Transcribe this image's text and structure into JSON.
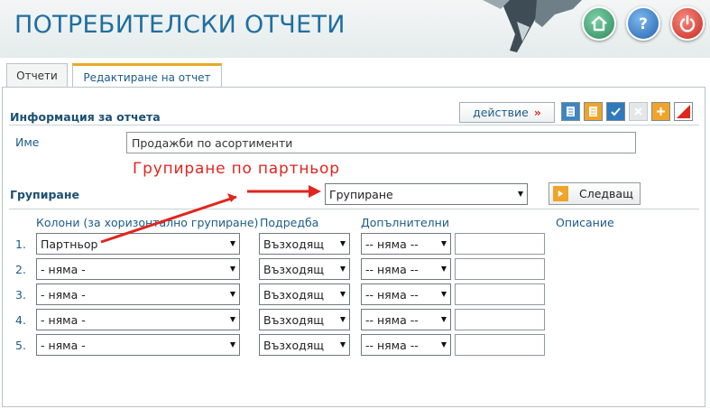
{
  "header": {
    "title": "ПОТРЕБИТЕЛСКИ ОТЧЕТИ",
    "buttons": [
      "home-icon",
      "help-icon",
      "power-icon"
    ]
  },
  "tabs": [
    {
      "label": "Отчети",
      "active": false
    },
    {
      "label": "Редактиране на отчет",
      "active": true
    }
  ],
  "report_info": {
    "title": "Информация за отчета",
    "action_label": "действие",
    "action_arrow": "»",
    "toolbar": [
      "report-icon",
      "report-alt-icon",
      "check-icon",
      "close-icon",
      "add-icon",
      "clear-icon"
    ]
  },
  "name": {
    "label": "Име",
    "value": "Продажби по асортименти"
  },
  "annotation": "Групиране по партньор",
  "grouping": {
    "label": "Групиране",
    "selected": "Групиране",
    "next_label": "Следващ"
  },
  "columns_header": {
    "columns": "Колони (за хоризонтално групиране)",
    "order": "Подредба",
    "additional": "Допълнителни",
    "description": "Описание"
  },
  "rows": [
    {
      "num": "1.",
      "column": "Партньор",
      "order": "Възходящ",
      "additional": "-- няма --",
      "description": ""
    },
    {
      "num": "2.",
      "column": "- няма -",
      "order": "Възходящ",
      "additional": "-- няма --",
      "description": ""
    },
    {
      "num": "3.",
      "column": "- няма -",
      "order": "Възходящ",
      "additional": "-- няма --",
      "description": ""
    },
    {
      "num": "4.",
      "column": "- няма -",
      "order": "Възходящ",
      "additional": "-- няма --",
      "description": ""
    },
    {
      "num": "5.",
      "column": "- няма -",
      "order": "Възходящ",
      "additional": "-- няма --",
      "description": ""
    }
  ],
  "colors": {
    "accent": "#1b5c8a",
    "annotation": "#e0261e",
    "tab_highlight": "#e9a825"
  }
}
